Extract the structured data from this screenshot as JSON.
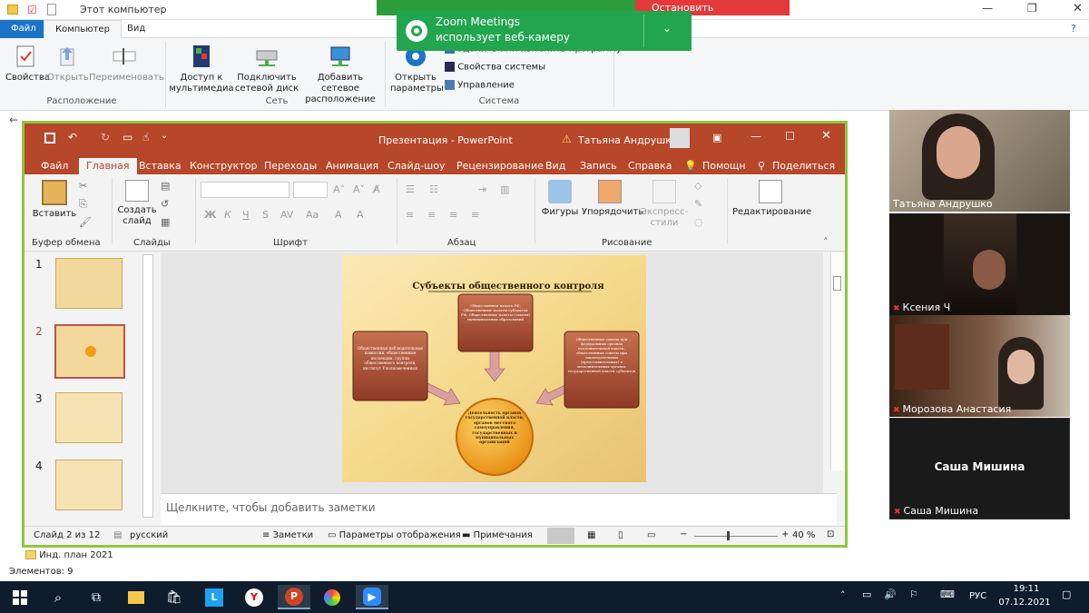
{
  "explorer": {
    "title": "Этот компьютер",
    "tabs": [
      "Файл",
      "Компьютер",
      "Вид"
    ],
    "ribbon_buttons": [
      {
        "label": "Свойства",
        "icon": "properties-icon"
      },
      {
        "label": "Открыть",
        "icon": "open-icon"
      },
      {
        "label": "Переименовать",
        "icon": "rename-icon"
      },
      {
        "label": "Доступ к мультимедиа",
        "icon": "media-access-icon"
      },
      {
        "label": "Подключить сетевой диск",
        "icon": "network-drive-icon"
      },
      {
        "label": "Добавить сетевое расположение",
        "icon": "add-network-location-icon"
      },
      {
        "label": "Открыть параметры",
        "icon": "settings-gear-icon"
      }
    ],
    "system_items": [
      "Удалить или изменить программу",
      "Свойства системы",
      "Управление"
    ],
    "groups": [
      "Расположение",
      "Сеть",
      "Система"
    ],
    "folder_item": "Инд. план 2021",
    "status": "Элементов: 9"
  },
  "zoom": {
    "stop_share": "Остановить демонстрацию",
    "popup_title": "Zoom Meetings",
    "popup_text": "использует веб-камеру"
  },
  "powerpoint": {
    "title": "Презентация  -  PowerPoint",
    "user": "Татьяна Андрушко",
    "tabs": [
      "Файл",
      "Главная",
      "Вставка",
      "Конструктор",
      "Переходы",
      "Анимация",
      "Слайд-шоу",
      "Рецензирование",
      "Вид",
      "Запись",
      "Справка",
      "Помощн",
      "Поделиться"
    ],
    "ribbon": {
      "paste": "Вставить",
      "create_slide": "Создать слайд",
      "shapes": "Фигуры",
      "arrange": "Упорядочить",
      "express_styles": "Экспресс-стили",
      "editing": "Редактирование",
      "groups": [
        "Буфер обмена",
        "Слайды",
        "Шрифт",
        "Абзац",
        "Рисование"
      ]
    },
    "thumb_numbers": [
      "1",
      "2",
      "3",
      "4"
    ],
    "notes_placeholder": "Щелкните, чтобы добавить заметки",
    "status": {
      "slide": "Слайд 2 из 12",
      "language": "русский",
      "notes": "Заметки",
      "display": "Параметры отображения",
      "comments": "Примечания",
      "zoom": "40 %"
    },
    "slide": {
      "title": "Субъекты общественного контроля",
      "box_top": "Общественная палата РФ, Общественные палаты субъектов РФ, Общественные палаты (советы) муниципальных образований",
      "box_left": "Общественные наблюдательные комиссии, общественные инспекции, группы общественного контроля, институт Уполномоченных",
      "box_right": "Общественные советы при федеральных органах исполнительной власти, общественные советы при законодательных (представительных) и исполнительных органах государственной власти субъектов",
      "circle": "Деятельность органов государственной власти, органов местного самоуправления, государственных и муниципальных организаций"
    }
  },
  "participants": [
    {
      "name": "Татьяна Андрушко",
      "muted": false
    },
    {
      "name": "Ксения Ч",
      "muted": true
    },
    {
      "name": "Морозова Анастасия",
      "muted": true
    },
    {
      "name": "Саша Мишина",
      "muted": true,
      "center_name": "Саша Мишина"
    }
  ],
  "taskbar": {
    "time": "19:11",
    "date": "07.12.2021",
    "lang": "РУС"
  },
  "colors": {
    "ppt_red": "#b7472a",
    "zoom_green": "#22a54f",
    "highlight_border": "#8dc63f",
    "taskbar": "#0e1c2c"
  }
}
